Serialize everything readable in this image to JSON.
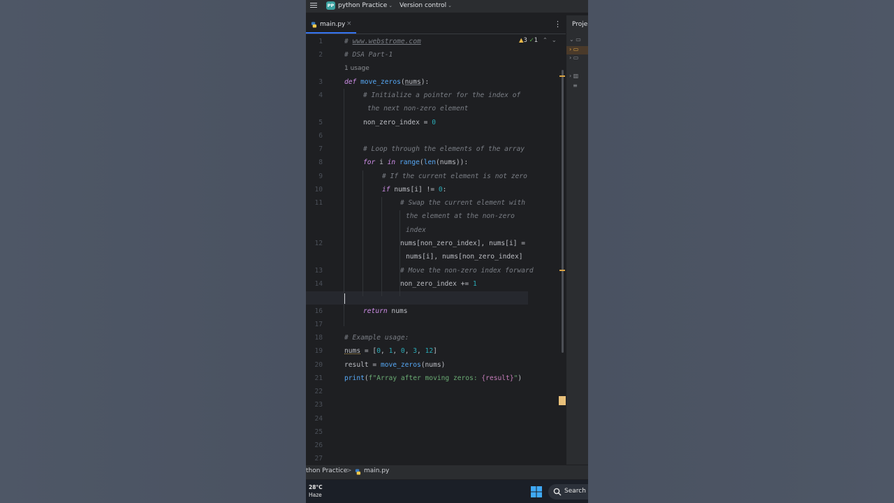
{
  "titlebar": {
    "project_badge": "PP",
    "project_name": "python Practice",
    "version_control": "Version control"
  },
  "tab": {
    "label": "main.py",
    "close": "×"
  },
  "inspections": {
    "warnings": "3",
    "ok": "1"
  },
  "right_panel": {
    "title": "Project"
  },
  "gutter": {
    "lines": [
      "1",
      "2",
      "3",
      "4",
      "5",
      "6",
      "7",
      "8",
      "9",
      "10",
      "11",
      "12",
      "13",
      "14",
      "15",
      "16",
      "17",
      "18",
      "19",
      "20",
      "21",
      "22",
      "23",
      "24",
      "25",
      "26",
      "27"
    ]
  },
  "code": {
    "l1_hash": "# ",
    "l1_url": "www.webstrome.com",
    "l2": "# DSA Part-1",
    "usage": "1 usage",
    "l3_def": "def",
    "l3_fn": "move_zeros",
    "l3_param": "nums",
    "l3_tail": "):",
    "l4a": "# Initialize a pointer for the index of",
    "l4b": "the next non-zero element",
    "l5_var": "non_zero_index = ",
    "l5_num": "0",
    "l7": "# Loop through the elements of the array",
    "l8_for": "for",
    "l8_i": " i ",
    "l8_in": "in",
    "l8_range": "range",
    "l8_len": "len",
    "l8_nums": "nums",
    "l8_tail": ")):",
    "l9": "# If the current element is not zero",
    "l10_if": "if",
    "l10_mid": " nums[i] != ",
    "l10_num": "0",
    "l10_tail": ":",
    "l11a": "# Swap the current element with",
    "l11b": "the element at the non-zero",
    "l11c": "index",
    "l12a": "nums[non_zero_index], nums[i] =",
    "l12b": "nums[i], nums[non_zero_index]",
    "l13": "# Move the non-zero index forward",
    "l14_var": "non_zero_index += ",
    "l14_num": "1",
    "l16_ret": "return",
    "l16_val": " nums",
    "l18": "# Example usage:",
    "l19_var": "nums",
    "l19_eq": " = [",
    "l19_n0": "0",
    "l19_n1": "1",
    "l19_n2": "0",
    "l19_n3": "3",
    "l19_n4": "12",
    "l19_sep": ", ",
    "l19_end": "]",
    "l20_var": "result = ",
    "l20_fn": "move_zeros",
    "l20_arg": "(nums)",
    "l21_fn": "print",
    "l21_open": "(",
    "l21_str": "f\"Array after moving zeros: ",
    "l21_var": "{result}",
    "l21_strend": "\"",
    "l21_close": ")"
  },
  "status": {
    "project": "thon Practice",
    "sep": ">",
    "file": "main.py"
  },
  "taskbar": {
    "temp": "28°C",
    "condition": "Haze",
    "search": "Search"
  },
  "colors": {
    "accent": "#3574f0",
    "keyword": "#cf8ee8",
    "function": "#56a8f5",
    "comment": "#7a7e85",
    "number": "#2aacb8",
    "string": "#6aab73"
  }
}
